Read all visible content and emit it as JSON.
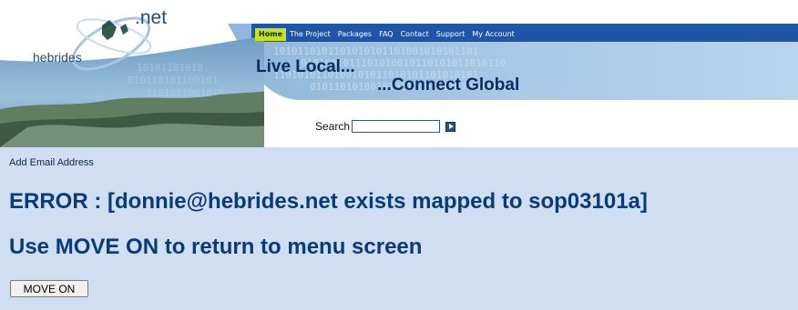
{
  "logo": {
    "brand": "hebrides",
    "suffix": ".net"
  },
  "nav": {
    "items": [
      {
        "label": "Home",
        "active": true
      },
      {
        "label": "The Project"
      },
      {
        "label": "Packages"
      },
      {
        "label": "FAQ"
      },
      {
        "label": "Contact"
      },
      {
        "label": "Support"
      },
      {
        "label": "My Account"
      }
    ]
  },
  "tagline": {
    "line1": "Live Local...",
    "line2": "...Connect Global"
  },
  "search": {
    "label": "Search",
    "value": ""
  },
  "breadcrumb": "Add Email Address",
  "message": {
    "error": "ERROR : [donnie@hebrides.net exists mapped to sop03101a]",
    "instruction": "Use MOVE ON to return to menu screen"
  },
  "move_on_button": "MOVE ON",
  "colors": {
    "nav_bar": "#1f55a6",
    "nav_active": "#c7e21a",
    "page_background": "#cfdef0",
    "heading_text": "#0a3a78"
  }
}
